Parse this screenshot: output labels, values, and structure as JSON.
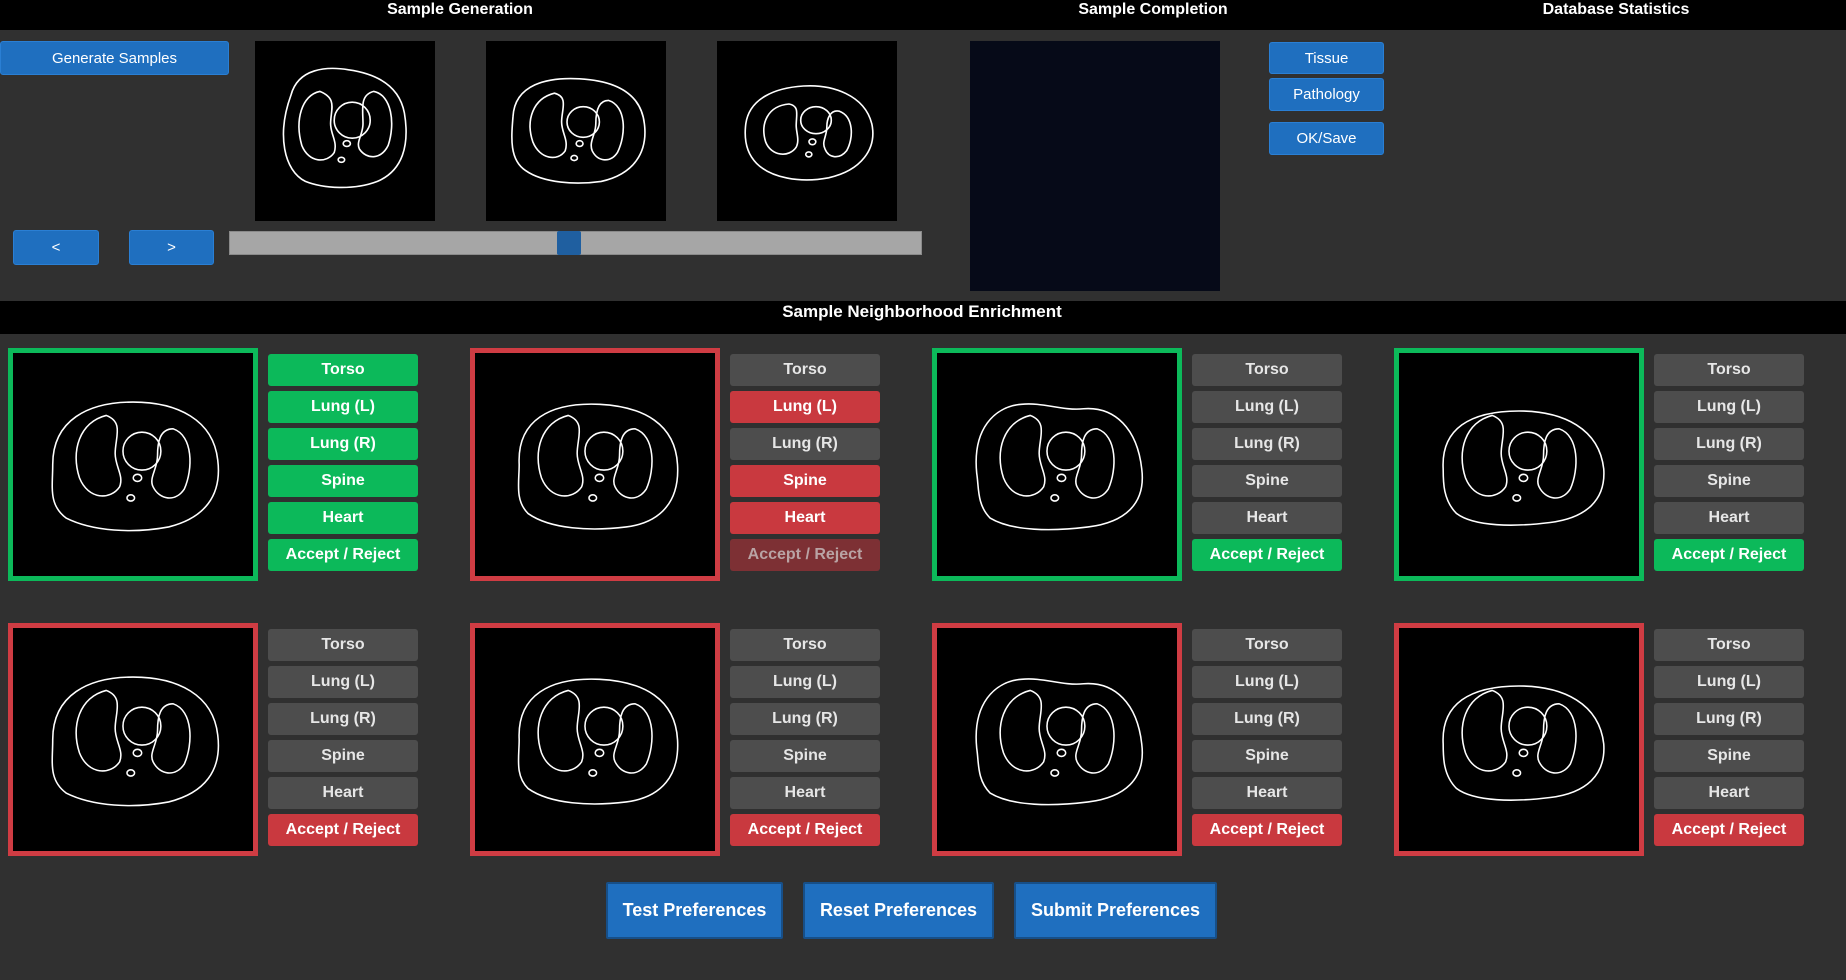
{
  "header": {
    "sample_generation": "Sample Generation",
    "sample_completion": "Sample Completion",
    "database_statistics": "Database Statistics"
  },
  "generation": {
    "generate_label": "Generate Samples",
    "prev_label": "<",
    "next_label": ">",
    "slider_position": 0.49
  },
  "completion": {
    "tissue_label": "Tissue",
    "pathology_label": "Pathology",
    "ok_save_label": "OK/Save"
  },
  "enrichment": {
    "title": "Sample Neighborhood Enrichment",
    "colors": {
      "green": "#0cb95a",
      "red": "#c9393f",
      "off": "#4d4d4d",
      "frame_green": "#0cb95a",
      "frame_red": "#cf3c43"
    },
    "samples": [
      {
        "frame": "green",
        "tags": [
          {
            "label": "Torso",
            "state": "green"
          },
          {
            "label": "Lung (L)",
            "state": "green"
          },
          {
            "label": "Lung (R)",
            "state": "green"
          },
          {
            "label": "Spine",
            "state": "green"
          },
          {
            "label": "Heart",
            "state": "green"
          },
          {
            "label": "Accept / Reject",
            "state": "green"
          }
        ]
      },
      {
        "frame": "red",
        "tags": [
          {
            "label": "Torso",
            "state": "off"
          },
          {
            "label": "Lung (L)",
            "state": "red"
          },
          {
            "label": "Lung (R)",
            "state": "off"
          },
          {
            "label": "Spine",
            "state": "red"
          },
          {
            "label": "Heart",
            "state": "red"
          },
          {
            "label": "Accept / Reject",
            "state": "dimred"
          }
        ]
      },
      {
        "frame": "green",
        "tags": [
          {
            "label": "Torso",
            "state": "off"
          },
          {
            "label": "Lung (L)",
            "state": "off"
          },
          {
            "label": "Lung (R)",
            "state": "off"
          },
          {
            "label": "Spine",
            "state": "off"
          },
          {
            "label": "Heart",
            "state": "off"
          },
          {
            "label": "Accept / Reject",
            "state": "green"
          }
        ]
      },
      {
        "frame": "green",
        "tags": [
          {
            "label": "Torso",
            "state": "off"
          },
          {
            "label": "Lung (L)",
            "state": "off"
          },
          {
            "label": "Lung (R)",
            "state": "off"
          },
          {
            "label": "Spine",
            "state": "off"
          },
          {
            "label": "Heart",
            "state": "off"
          },
          {
            "label": "Accept / Reject",
            "state": "green"
          }
        ]
      },
      {
        "frame": "red",
        "tags": [
          {
            "label": "Torso",
            "state": "off"
          },
          {
            "label": "Lung (L)",
            "state": "off"
          },
          {
            "label": "Lung (R)",
            "state": "off"
          },
          {
            "label": "Spine",
            "state": "off"
          },
          {
            "label": "Heart",
            "state": "off"
          },
          {
            "label": "Accept / Reject",
            "state": "red"
          }
        ]
      },
      {
        "frame": "red",
        "tags": [
          {
            "label": "Torso",
            "state": "off"
          },
          {
            "label": "Lung (L)",
            "state": "off"
          },
          {
            "label": "Lung (R)",
            "state": "off"
          },
          {
            "label": "Spine",
            "state": "off"
          },
          {
            "label": "Heart",
            "state": "off"
          },
          {
            "label": "Accept / Reject",
            "state": "red"
          }
        ]
      },
      {
        "frame": "red",
        "tags": [
          {
            "label": "Torso",
            "state": "off"
          },
          {
            "label": "Lung (L)",
            "state": "off"
          },
          {
            "label": "Lung (R)",
            "state": "off"
          },
          {
            "label": "Spine",
            "state": "off"
          },
          {
            "label": "Heart",
            "state": "off"
          },
          {
            "label": "Accept / Reject",
            "state": "red"
          }
        ]
      },
      {
        "frame": "red",
        "tags": [
          {
            "label": "Torso",
            "state": "off"
          },
          {
            "label": "Lung (L)",
            "state": "off"
          },
          {
            "label": "Lung (R)",
            "state": "off"
          },
          {
            "label": "Spine",
            "state": "off"
          },
          {
            "label": "Heart",
            "state": "off"
          },
          {
            "label": "Accept / Reject",
            "state": "red"
          }
        ]
      }
    ]
  },
  "footer": {
    "test_label": "Test Preferences",
    "reset_label": "Reset Preferences",
    "submit_label": "Submit Preferences"
  }
}
